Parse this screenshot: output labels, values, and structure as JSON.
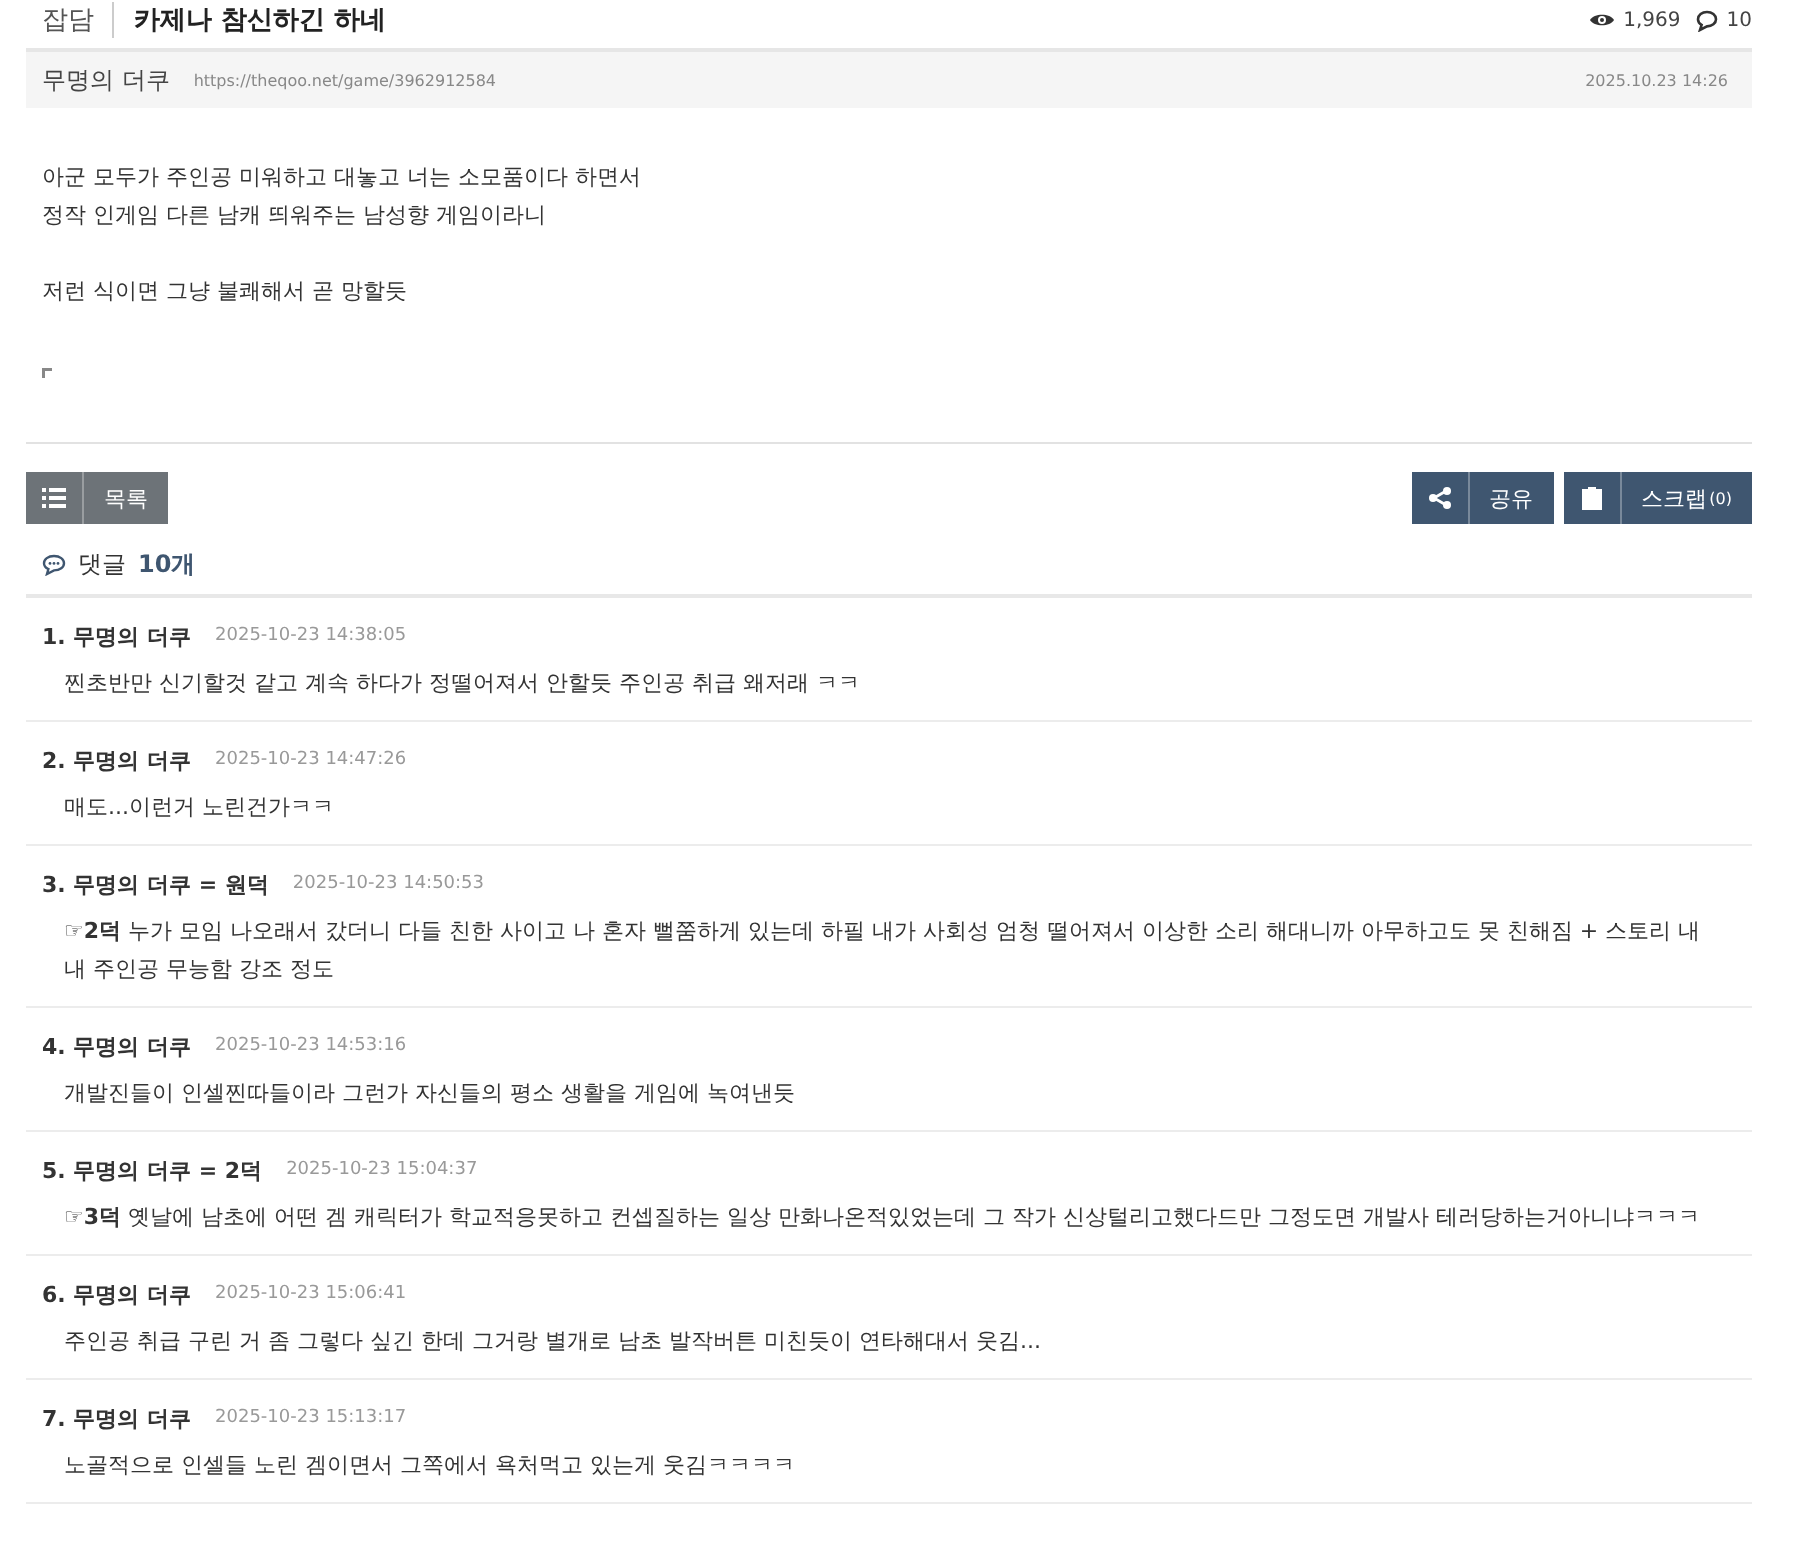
{
  "post": {
    "category": "잡담",
    "title": "카제나 참신하긴 하네",
    "views": "1,969",
    "comment_count": "10",
    "author": "무명의 더쿠",
    "url": "https://theqoo.net/game/3962912584",
    "date": "2025.10.23 14:26",
    "body": [
      "아군 모두가 주인공 미워하고 대놓고 너는 소모품이다 하면서\n정작 인게임 다른 남캐 띄워주는 남성향 게임이라니",
      "저런 식이면 그냥 불쾌해서 곧 망할듯"
    ]
  },
  "buttons": {
    "list": "목록",
    "share": "공유",
    "scrap": "스크랩",
    "scrap_count": "(0)"
  },
  "comments_header": {
    "label": "댓글",
    "count": "10개"
  },
  "comments": [
    {
      "number": "1.",
      "author": "무명의 더쿠",
      "time": "2025-10-23 14:38:05",
      "text": "찐초반만 신기할것 같고 계속 하다가 정떨어져서 안할듯 주인공 취급 왜저래 ㅋㅋ"
    },
    {
      "number": "2.",
      "author": "무명의 더쿠",
      "time": "2025-10-23 14:47:26",
      "text": "매도...이런거 노린건가ㅋㅋ"
    },
    {
      "number": "3.",
      "author": "무명의 더쿠",
      "tag": "= 원덕",
      "time": "2025-10-23 14:50:53",
      "text": "**☞2덕** 누가 모임 나오래서 갔더니 다들 친한 사이고 나 혼자 뻘쭘하게 있는데 하필 내가 사회성 엄청 떨어져서 이상한 소리 해대니까 아무하고도 못 친해짐 + 스토리 내내 주인공 무능함 강조 정도"
    },
    {
      "number": "4.",
      "author": "무명의 더쿠",
      "time": "2025-10-23 14:53:16",
      "text": "개발진들이 인셀찐따들이라 그런가 자신들의 평소 생활을 게임에 녹여낸듯"
    },
    {
      "number": "5.",
      "author": "무명의 더쿠",
      "tag": "= 2덕",
      "time": "2025-10-23 15:04:37",
      "text": "**☞3덕** 옛날에 남초에 어떤 겜 캐릭터가 학교적응못하고 컨셉질하는 일상 만화나온적있었는데 그 작가 신상털리고했다드만 그정도면 개발사 테러당하는거아니냐ㅋㅋㅋ"
    },
    {
      "number": "6.",
      "author": "무명의 더쿠",
      "time": "2025-10-23 15:06:41",
      "text": "주인공 취급 구린 거 좀 그렇다 싶긴 한데 그거랑 별개로 남초 발작버튼 미친듯이 연타해대서 웃김..."
    },
    {
      "number": "7.",
      "author": "무명의 더쿠",
      "time": "2025-10-23 15:13:17",
      "text": "노골적으로 인셀들 노린 겜이면서 그쪽에서 욕처먹고 있는게 웃김ㅋㅋㅋㅋ"
    }
  ]
}
